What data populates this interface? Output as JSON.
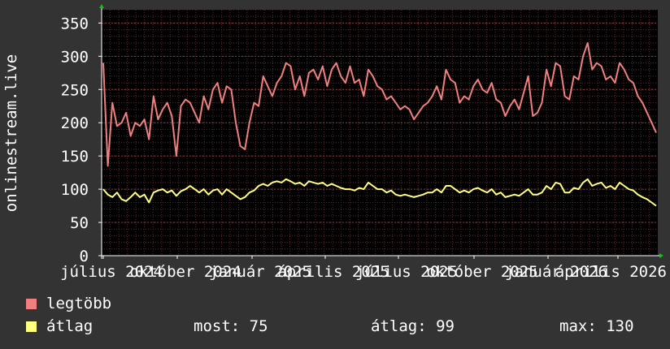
{
  "chart_data": {
    "type": "line",
    "ylabel": "onlinestream.live",
    "ylim": [
      0,
      370
    ],
    "yticks": [
      0,
      50,
      100,
      150,
      200,
      250,
      300,
      350
    ],
    "x_tick_labels": [
      "július 2024",
      "október 2024",
      "január 2025",
      "április 2025",
      "július 2025",
      "október 2025",
      "január 2026",
      "április 2026"
    ],
    "grid": true,
    "colors": {
      "background": "#333333",
      "plot_bg": "#000000",
      "grid": "#5a2a2a",
      "text": "#ffffff",
      "axis_arrow": "#00cc00"
    },
    "series": [
      {
        "name": "legtöbb",
        "color": "#f08080",
        "values": [
          290,
          135,
          230,
          195,
          200,
          215,
          180,
          200,
          195,
          205,
          175,
          240,
          205,
          220,
          230,
          210,
          150,
          225,
          235,
          230,
          215,
          200,
          240,
          220,
          250,
          260,
          230,
          255,
          250,
          200,
          165,
          160,
          200,
          230,
          225,
          270,
          255,
          240,
          260,
          270,
          290,
          285,
          250,
          270,
          240,
          275,
          280,
          265,
          285,
          255,
          280,
          290,
          270,
          260,
          285,
          260,
          265,
          240,
          280,
          270,
          255,
          250,
          235,
          240,
          230,
          220,
          225,
          220,
          205,
          215,
          225,
          230,
          240,
          255,
          235,
          280,
          265,
          260,
          230,
          240,
          235,
          255,
          265,
          250,
          245,
          260,
          235,
          230,
          210,
          225,
          235,
          220,
          245,
          270,
          210,
          215,
          230,
          280,
          255,
          290,
          285,
          240,
          235,
          270,
          265,
          300,
          320,
          280,
          290,
          285,
          265,
          270,
          260,
          290,
          280,
          265,
          260,
          240,
          230,
          215,
          200,
          185
        ]
      },
      {
        "name": "átlag",
        "color": "#ffff80",
        "values": [
          100,
          92,
          88,
          95,
          85,
          82,
          88,
          95,
          88,
          92,
          80,
          95,
          98,
          100,
          95,
          98,
          90,
          97,
          100,
          105,
          100,
          95,
          100,
          92,
          98,
          100,
          92,
          100,
          95,
          90,
          85,
          88,
          95,
          98,
          105,
          108,
          105,
          110,
          112,
          110,
          115,
          112,
          108,
          110,
          105,
          112,
          110,
          108,
          110,
          105,
          108,
          105,
          102,
          100,
          100,
          98,
          102,
          100,
          110,
          105,
          100,
          100,
          95,
          98,
          92,
          90,
          92,
          90,
          88,
          90,
          92,
          95,
          95,
          100,
          95,
          105,
          105,
          100,
          95,
          98,
          95,
          100,
          102,
          98,
          95,
          100,
          92,
          95,
          88,
          90,
          92,
          90,
          95,
          100,
          92,
          92,
          95,
          105,
          100,
          110,
          108,
          95,
          95,
          102,
          100,
          110,
          115,
          105,
          108,
          110,
          102,
          105,
          100,
          110,
          105,
          100,
          98,
          92,
          88,
          85,
          80,
          75
        ]
      }
    ]
  },
  "legend": {
    "items": [
      {
        "label": "legtöbb",
        "color": "#f08080"
      },
      {
        "label": "átlag",
        "color": "#ffff80"
      }
    ],
    "stats": {
      "most": "most: 75",
      "atlag": "átlag: 99",
      "max": "max: 130"
    }
  }
}
